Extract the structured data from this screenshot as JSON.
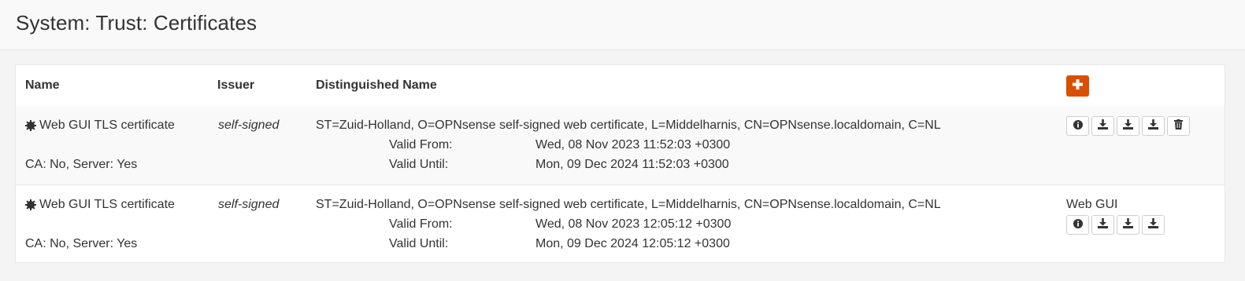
{
  "page": {
    "title": "System: Trust: Certificates"
  },
  "table": {
    "headers": {
      "name": "Name",
      "issuer": "Issuer",
      "dn": "Distinguished Name"
    },
    "rows": [
      {
        "name": "Web GUI TLS certificate",
        "ca_server": "CA: No, Server: Yes",
        "issuer": "self-signed",
        "dn": "ST=Zuid-Holland, O=OPNsense self-signed web certificate, L=Middelharnis, CN=OPNsense.localdomain, C=NL",
        "valid_from_label": "Valid From:",
        "valid_from": "Wed, 08 Nov 2023 11:52:03 +0300",
        "valid_until_label": "Valid Until:",
        "valid_until": "Mon, 09 Dec 2024 11:52:03 +0300",
        "purpose": "",
        "actions": [
          "info-icon",
          "download-icon",
          "download-icon",
          "download-icon",
          "trash-icon"
        ]
      },
      {
        "name": "Web GUI TLS certificate",
        "ca_server": "CA: No, Server: Yes",
        "issuer": "self-signed",
        "dn": "ST=Zuid-Holland, O=OPNsense self-signed web certificate, L=Middelharnis, CN=OPNsense.localdomain, C=NL",
        "valid_from_label": "Valid From:",
        "valid_from": "Wed, 08 Nov 2023 12:05:12 +0300",
        "valid_until_label": "Valid Until:",
        "valid_until": "Mon, 09 Dec 2024 12:05:12 +0300",
        "purpose": "Web GUI",
        "actions": [
          "info-icon",
          "download-icon",
          "download-icon",
          "download-icon"
        ]
      }
    ]
  },
  "colors": {
    "accent": "#d94f00",
    "text": "#333333",
    "background": "#f4f4f4"
  },
  "icons": {
    "add": "plus-icon",
    "cert": "gear-icon"
  }
}
